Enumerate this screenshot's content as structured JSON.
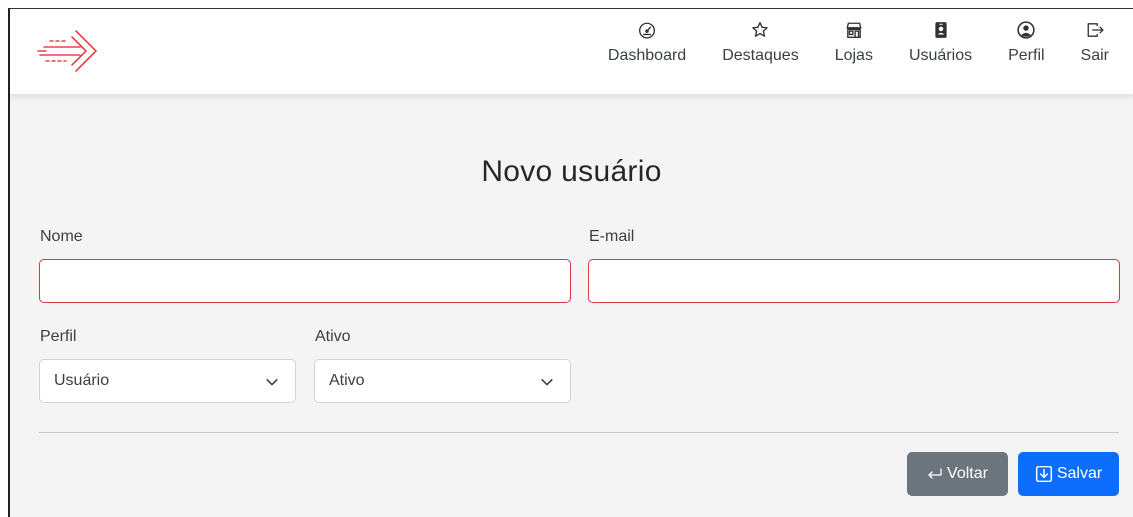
{
  "nav": {
    "items": [
      {
        "label": "Dashboard",
        "icon": "speedometer-icon"
      },
      {
        "label": "Destaques",
        "icon": "star-icon"
      },
      {
        "label": "Lojas",
        "icon": "shop-icon"
      },
      {
        "label": "Usuários",
        "icon": "person-badge-icon"
      },
      {
        "label": "Perfil",
        "icon": "person-circle-icon"
      },
      {
        "label": "Sair",
        "icon": "box-arrow-right-icon"
      }
    ]
  },
  "page": {
    "title": "Novo usuário"
  },
  "form": {
    "name_label": "Nome",
    "name_value": "",
    "email_label": "E-mail",
    "email_value": "",
    "profile_label": "Perfil",
    "profile_value": "Usuário",
    "active_label": "Ativo",
    "active_value": "Ativo"
  },
  "actions": {
    "back_label": "Voltar",
    "save_label": "Salvar"
  },
  "colors": {
    "accent": "#0d6efd",
    "secondary": "#6c757d",
    "invalid": "#dc3545",
    "logo": "#e8434b"
  }
}
